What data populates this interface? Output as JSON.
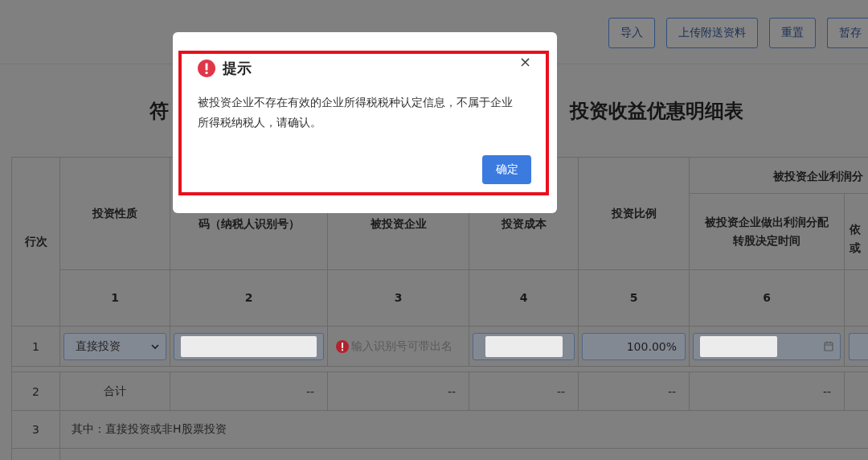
{
  "toolbar": {
    "buttons": [
      "导入",
      "上传附送资料",
      "重置",
      "暂存"
    ]
  },
  "title": {
    "left": "符",
    "right": "投资收益优惠明细表"
  },
  "table": {
    "group_header": "被投资企业利润分",
    "columns": [
      {
        "lines": [
          "行次"
        ]
      },
      {
        "lines": [
          "投资性质"
        ]
      },
      {
        "lines": [
          "码（纳税人识别号）"
        ]
      },
      {
        "lines": [
          "被投资企业"
        ]
      },
      {
        "lines": [
          "投资成本"
        ]
      },
      {
        "lines": [
          "投资比例"
        ]
      },
      {
        "lines": [
          "被投资企业做出利润分配",
          "转股决定时间"
        ]
      },
      {
        "lines": [
          "依",
          "或"
        ]
      }
    ],
    "column_numbers": [
      "1",
      "2",
      "3",
      "4",
      "5",
      "6"
    ],
    "rows": [
      {
        "kind": "inputs",
        "row_no": "1",
        "cells": [
          {
            "kind": "select",
            "value": "直接投资"
          },
          {
            "kind": "masked"
          },
          {
            "kind": "hint",
            "placeholder": "输入识别号可带出名"
          },
          {
            "kind": "masked"
          },
          {
            "kind": "value",
            "value": "100.00%"
          },
          {
            "kind": "date"
          },
          {
            "kind": "cut"
          }
        ]
      },
      {
        "kind": "total",
        "row_no": "2",
        "label": "合计",
        "values": [
          "--",
          "--",
          "--",
          "--",
          "--"
        ]
      },
      {
        "kind": "note",
        "row_no": "3",
        "label": "其中：直接投资或非H股票投资"
      }
    ]
  },
  "dialog": {
    "title": "提示",
    "close": "×",
    "message": "被投资企业不存在有效的企业所得税税种认定信息，不属于企业所得税纳税人，请确认。",
    "button": "确定",
    "highlighted": true
  }
}
